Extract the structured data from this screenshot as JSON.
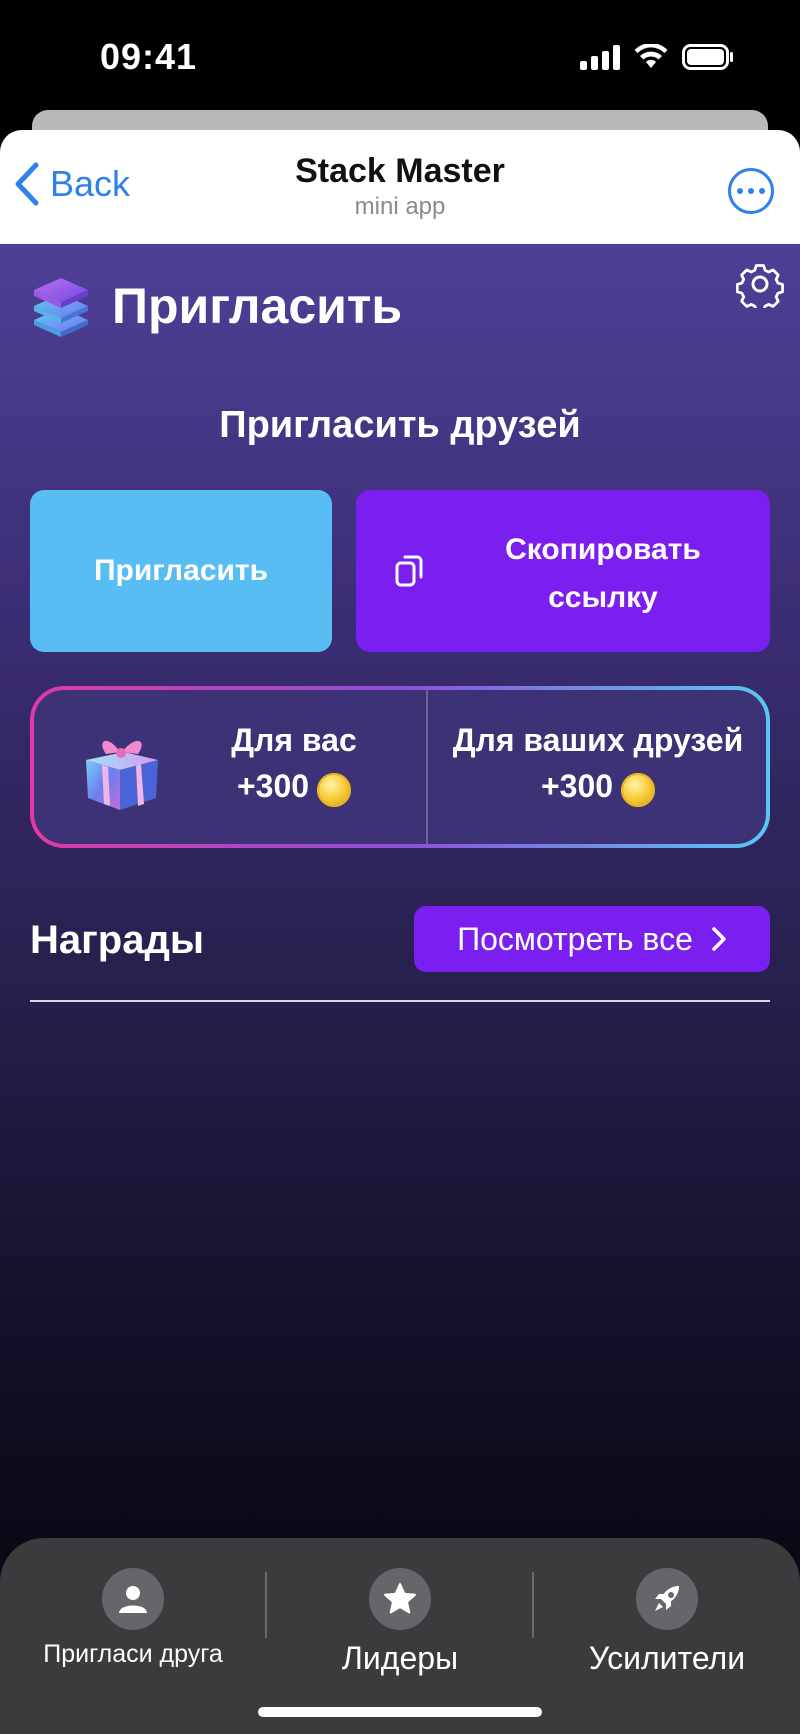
{
  "status_bar": {
    "time": "09:41"
  },
  "header": {
    "back_label": "Back",
    "title": "Stack Master",
    "subtitle": "mini app"
  },
  "page": {
    "title": "Пригласить"
  },
  "invite": {
    "section_title": "Пригласить друзей",
    "invite_button": "Пригласить",
    "copy_button_line1": "Скопировать",
    "copy_button_line2": "ссылку"
  },
  "reward_card": {
    "you_label": "Для вас",
    "you_value": "+300",
    "friends_label": "Для ваших друзей",
    "friends_value": "+300"
  },
  "rewards": {
    "title": "Награды",
    "view_all": "Посмотреть все"
  },
  "bottom_nav": {
    "items": [
      {
        "label": "Пригласи друга",
        "icon": "user-icon"
      },
      {
        "label": "Лидеры",
        "icon": "star-icon"
      },
      {
        "label": "Усилители",
        "icon": "rocket-icon"
      }
    ]
  },
  "colors": {
    "accent_blue": "#2f80ed",
    "invite_button": "#58bdf2",
    "purple_button": "#7a1ff0",
    "card_gradient": [
      "#e03aa8",
      "#58c8f4"
    ]
  }
}
